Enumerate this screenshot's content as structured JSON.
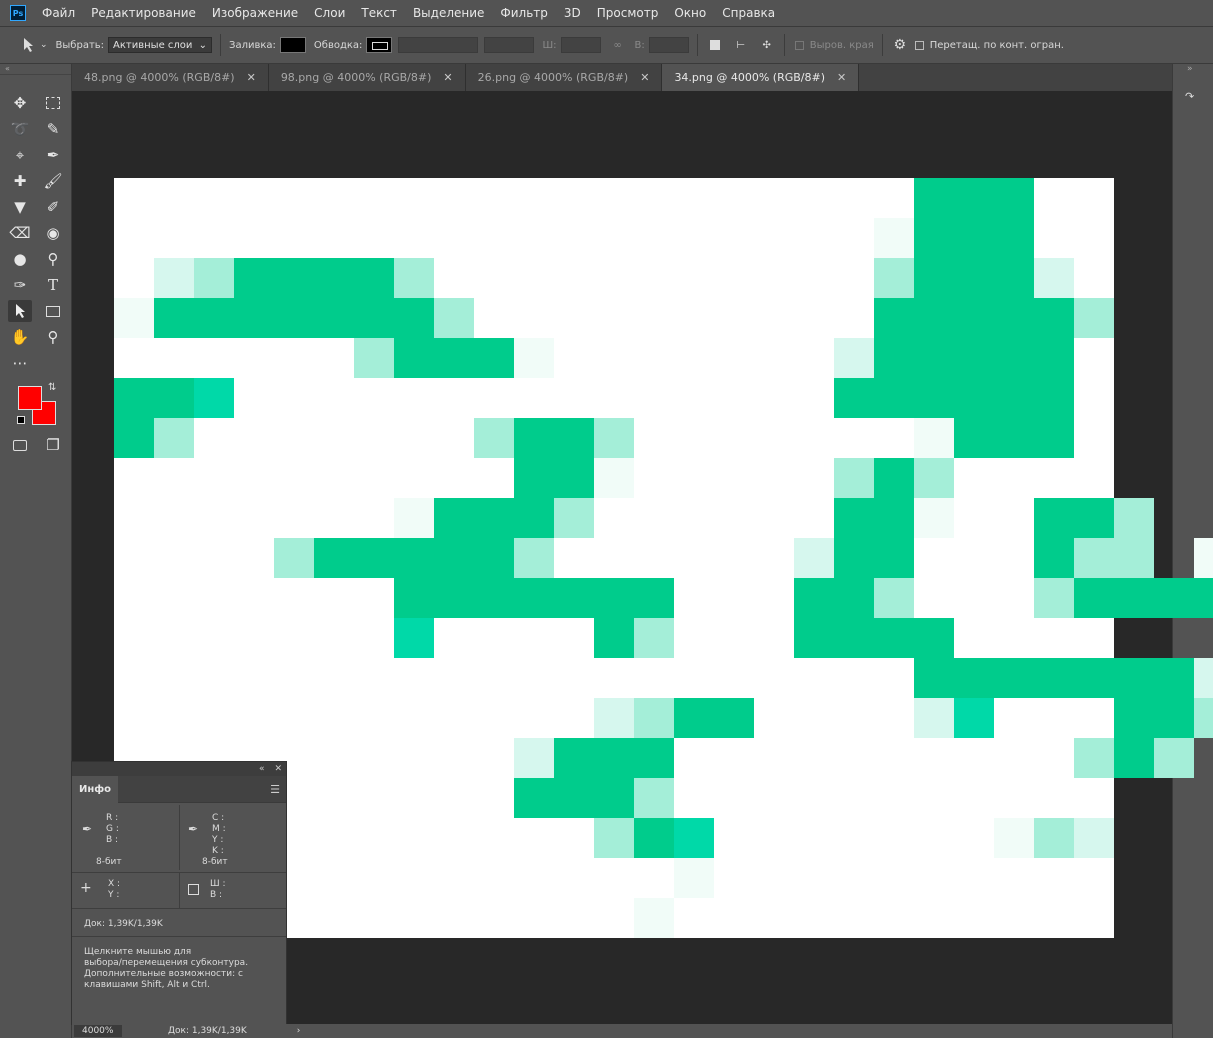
{
  "app": {
    "logo": "Ps"
  },
  "menu": [
    "Файл",
    "Редактирование",
    "Изображение",
    "Слои",
    "Текст",
    "Выделение",
    "Фильтр",
    "3D",
    "Просмотр",
    "Окно",
    "Справка"
  ],
  "options": {
    "select_label": "Выбрать:",
    "select_value": "Активные слои",
    "fill_label": "Заливка:",
    "stroke_label": "Обводка:",
    "w_label": "Ш:",
    "h_label": "В:",
    "align_edges": "Выров. края",
    "constrain": "Перетащ. по конт. огран."
  },
  "tabs": [
    {
      "label": "48.png @ 4000% (RGB/8#)",
      "active": false
    },
    {
      "label": "98.png @ 4000% (RGB/8#)",
      "active": false
    },
    {
      "label": "26.png @ 4000% (RGB/8#)",
      "active": false
    },
    {
      "label": "34.png @ 4000% (RGB/8#)",
      "active": true
    }
  ],
  "colors": {
    "foreground": "#ff0000",
    "background": "#ff0000",
    "accent": "#00cc8c"
  },
  "info_panel": {
    "tab": "Инфо",
    "rgb": [
      "R :",
      "G :",
      "B :"
    ],
    "cmyk": [
      "C :",
      "M :",
      "Y :",
      "K :"
    ],
    "bits_left": "8-бит",
    "bits_right": "8-бит",
    "xy": [
      "X :",
      "Y :"
    ],
    "wh": [
      "Ш :",
      "В :"
    ],
    "doc": "Док: 1,39K/1,39K",
    "hint": [
      "Щелкните мышью для",
      "выбора/перемещения субконтура.",
      "Дополнительные возможности: с",
      "клавишами Shift, Alt и Ctrl."
    ]
  },
  "status": {
    "zoom": "4000%",
    "doc": "Док: 1,39K/1,39K"
  },
  "pixel_rows": [
    "....................aaa.....",
    "...................paaa.....",
    ".lbaaaab...........baaal....",
    "paaaaaaab..........aaaaab...",
    "......baaap.......laaaaa....",
    "aaq...............aaaaaa....",
    "ab.......baab.......paaa....",
    "..........aap.....bab.......",
    ".......paaab......aap..aab..",
    "....baaaaab......laa...abb.p",
    ".......aaaaaaa...aab...baaaa",
    ".......q....ab...aaaa.......",
    "....................aaaaaaal",
    "............lbaa....lq...aab",
    "..........laaa..........bab.",
    "..........aaab..............",
    "............baq.......pbl...",
    "..............p.............",
    ".............p.............."
  ]
}
